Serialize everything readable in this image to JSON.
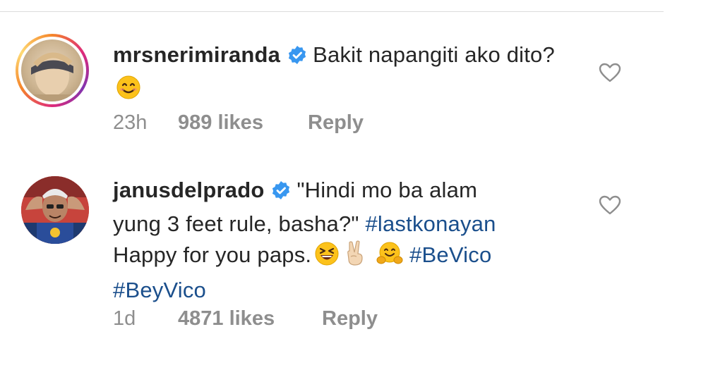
{
  "comments": [
    {
      "username": "mrsnerimiranda",
      "text": "Bakit napangiti ako dito?",
      "time": "23h",
      "likes": "989 likes",
      "reply": "Reply"
    },
    {
      "username": "janusdelprado",
      "text_line1": "\"Hindi mo ba alam",
      "text_line2": "yung 3 feet rule, basha?\"",
      "hashtag1": "#lastkonayan",
      "text_line3": "Happy for you paps.",
      "hashtag2": "#BeVico",
      "hashtag3": "#BeyVico",
      "time": "1d",
      "likes": "4871 likes",
      "reply": "Reply"
    }
  ],
  "icons": [
    "verified-badge-icon",
    "heart-icon",
    "smiling-face-emoji",
    "laughing-face-emoji",
    "victory-hand-emoji",
    "hugging-face-emoji"
  ],
  "colors": {
    "hashtag": "#1b4f8c",
    "verified": "#3897f0",
    "meta": "#8e8e8e"
  }
}
